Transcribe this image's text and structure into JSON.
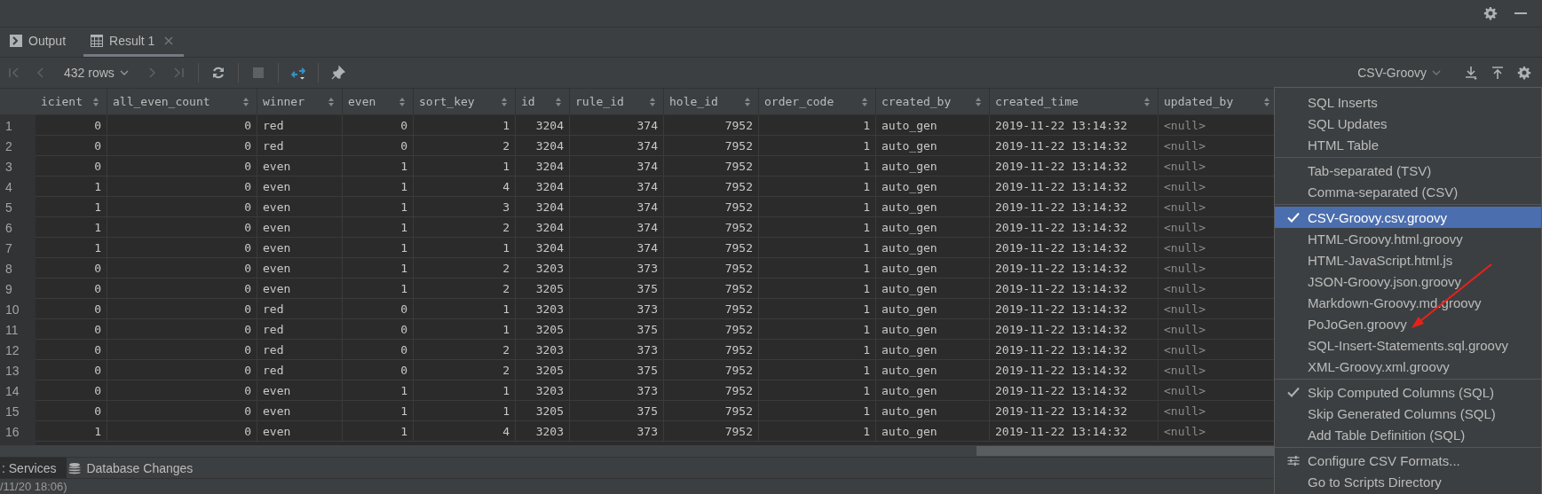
{
  "tool_tabs": [
    {
      "label": "Output",
      "kind": "console",
      "selected": false
    },
    {
      "label": "Result 1",
      "kind": "table",
      "selected": true
    }
  ],
  "toolbar": {
    "buttons": [
      {
        "kind": "first",
        "disabled": true
      },
      {
        "kind": "prev",
        "disabled": true
      },
      {
        "kind": "rows",
        "label": "432 rows"
      },
      {
        "kind": "next",
        "disabled": true
      },
      {
        "kind": "last",
        "disabled": true
      },
      {
        "kind": "refresh",
        "disabled": false
      },
      {
        "kind": "stop",
        "disabled": true
      },
      {
        "kind": "compare",
        "disabled": false
      },
      {
        "kind": "pin",
        "disabled": false
      }
    ],
    "extractor": "CSV-Groovy"
  },
  "table": {
    "columns": [
      {
        "label": "icient",
        "kind": "number"
      },
      {
        "label": "all_even_count",
        "kind": "number"
      },
      {
        "label": "winner",
        "kind": "text"
      },
      {
        "label": "even",
        "kind": "number"
      },
      {
        "label": "sort_key",
        "kind": "number"
      },
      {
        "label": "id",
        "kind": "number"
      },
      {
        "label": "rule_id",
        "kind": "number"
      },
      {
        "label": "hole_id",
        "kind": "number"
      },
      {
        "label": "order_code",
        "kind": "number"
      },
      {
        "label": "created_by",
        "kind": "text"
      },
      {
        "label": "created_time",
        "kind": "text"
      },
      {
        "label": "updated_by",
        "kind": "muted"
      }
    ],
    "rows": [
      {
        "number": "1",
        "cells": [
          "0",
          "0",
          "red",
          "0",
          "1",
          "3204",
          "374",
          "7952",
          "1",
          "auto_gen",
          "2019-11-22 13:14:32",
          "<null>"
        ]
      },
      {
        "number": "2",
        "cells": [
          "0",
          "0",
          "red",
          "0",
          "2",
          "3204",
          "374",
          "7952",
          "1",
          "auto_gen",
          "2019-11-22 13:14:32",
          "<null>"
        ]
      },
      {
        "number": "3",
        "cells": [
          "0",
          "0",
          "even",
          "1",
          "1",
          "3204",
          "374",
          "7952",
          "1",
          "auto_gen",
          "2019-11-22 13:14:32",
          "<null>"
        ]
      },
      {
        "number": "4",
        "cells": [
          "1",
          "0",
          "even",
          "1",
          "4",
          "3204",
          "374",
          "7952",
          "1",
          "auto_gen",
          "2019-11-22 13:14:32",
          "<null>"
        ]
      },
      {
        "number": "5",
        "cells": [
          "1",
          "0",
          "even",
          "1",
          "3",
          "3204",
          "374",
          "7952",
          "1",
          "auto_gen",
          "2019-11-22 13:14:32",
          "<null>"
        ]
      },
      {
        "number": "6",
        "cells": [
          "1",
          "0",
          "even",
          "1",
          "2",
          "3204",
          "374",
          "7952",
          "1",
          "auto_gen",
          "2019-11-22 13:14:32",
          "<null>"
        ]
      },
      {
        "number": "7",
        "cells": [
          "1",
          "0",
          "even",
          "1",
          "1",
          "3204",
          "374",
          "7952",
          "1",
          "auto_gen",
          "2019-11-22 13:14:32",
          "<null>"
        ]
      },
      {
        "number": "8",
        "cells": [
          "0",
          "0",
          "even",
          "1",
          "2",
          "3203",
          "373",
          "7952",
          "1",
          "auto_gen",
          "2019-11-22 13:14:32",
          "<null>"
        ]
      },
      {
        "number": "9",
        "cells": [
          "0",
          "0",
          "even",
          "1",
          "2",
          "3205",
          "375",
          "7952",
          "1",
          "auto_gen",
          "2019-11-22 13:14:32",
          "<null>"
        ]
      },
      {
        "number": "10",
        "cells": [
          "0",
          "0",
          "red",
          "0",
          "1",
          "3203",
          "373",
          "7952",
          "1",
          "auto_gen",
          "2019-11-22 13:14:32",
          "<null>"
        ]
      },
      {
        "number": "11",
        "cells": [
          "0",
          "0",
          "red",
          "0",
          "1",
          "3205",
          "375",
          "7952",
          "1",
          "auto_gen",
          "2019-11-22 13:14:32",
          "<null>"
        ]
      },
      {
        "number": "12",
        "cells": [
          "0",
          "0",
          "red",
          "0",
          "2",
          "3203",
          "373",
          "7952",
          "1",
          "auto_gen",
          "2019-11-22 13:14:32",
          "<null>"
        ]
      },
      {
        "number": "13",
        "cells": [
          "0",
          "0",
          "red",
          "0",
          "2",
          "3205",
          "375",
          "7952",
          "1",
          "auto_gen",
          "2019-11-22 13:14:32",
          "<null>"
        ]
      },
      {
        "number": "14",
        "cells": [
          "0",
          "0",
          "even",
          "1",
          "1",
          "3203",
          "373",
          "7952",
          "1",
          "auto_gen",
          "2019-11-22 13:14:32",
          "<null>"
        ]
      },
      {
        "number": "15",
        "cells": [
          "0",
          "0",
          "even",
          "1",
          "1",
          "3205",
          "375",
          "7952",
          "1",
          "auto_gen",
          "2019-11-22 13:14:32",
          "<null>"
        ]
      },
      {
        "number": "16",
        "cells": [
          "1",
          "0",
          "even",
          "1",
          "4",
          "3203",
          "373",
          "7952",
          "1",
          "auto_gen",
          "2019-11-22 13:14:32",
          "<null>"
        ]
      }
    ]
  },
  "menu": {
    "groups": [
      {
        "items": [
          {
            "label": "SQL Inserts",
            "kind": "option"
          },
          {
            "label": "SQL Updates",
            "kind": "option"
          },
          {
            "label": "HTML Table",
            "kind": "option"
          }
        ]
      },
      {
        "items": [
          {
            "label": "Tab-separated (TSV)",
            "kind": "option"
          },
          {
            "label": "Comma-separated (CSV)",
            "kind": "option"
          }
        ]
      },
      {
        "items": [
          {
            "label": "CSV-Groovy.csv.groovy",
            "kind": "option",
            "selected": true
          },
          {
            "label": "HTML-Groovy.html.groovy",
            "kind": "option",
            "selected": false
          },
          {
            "label": "HTML-JavaScript.html.js",
            "kind": "option",
            "selected": false
          },
          {
            "label": "JSON-Groovy.json.groovy",
            "kind": "option",
            "selected": false
          },
          {
            "label": "Markdown-Groovy.md.groovy",
            "kind": "option",
            "selected": false
          },
          {
            "label": "PoJoGen.groovy",
            "kind": "option",
            "selected": false
          },
          {
            "label": "SQL-Insert-Statements.sql.groovy",
            "kind": "option",
            "selected": false
          },
          {
            "label": "XML-Groovy.xml.groovy",
            "kind": "option",
            "selected": false
          }
        ]
      },
      {
        "items": [
          {
            "label": "Skip Computed Columns (SQL)",
            "kind": "toggle",
            "checked": true
          },
          {
            "label": "Skip Generated Columns (SQL)",
            "kind": "toggle",
            "checked": false
          },
          {
            "label": "Add Table Definition (SQL)",
            "kind": "toggle",
            "checked": false
          }
        ]
      },
      {
        "items": [
          {
            "label": "Configure CSV Formats...",
            "kind": "configure"
          },
          {
            "label": "Go to Scripts Directory",
            "kind": "link"
          }
        ]
      }
    ]
  },
  "bottom_tabs": [
    {
      "label": ": Services",
      "kind": "services",
      "selected": true
    },
    {
      "label": "Database Changes",
      "kind": "changes",
      "selected": false
    }
  ],
  "status_bar": {
    "text": "/11/20 18:06)"
  }
}
